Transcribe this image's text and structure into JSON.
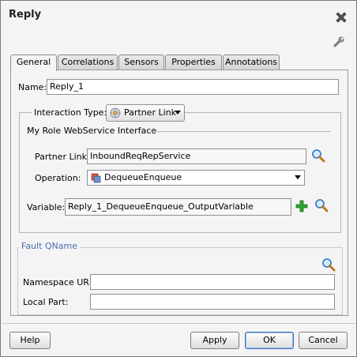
{
  "dialog": {
    "title": "Reply"
  },
  "tabs": [
    {
      "label": "General",
      "active": true
    },
    {
      "label": "Correlations",
      "active": false
    },
    {
      "label": "Sensors",
      "active": false
    },
    {
      "label": "Properties",
      "active": false
    },
    {
      "label": "Annotations",
      "active": false
    }
  ],
  "general": {
    "name_label": "Name:",
    "name_value": "Reply_1",
    "interaction_type_label": "Interaction Type:",
    "interaction_type_value": "Partner Link",
    "role_section_label": "My Role WebService Interface",
    "partner_link_label": "Partner Link:",
    "partner_link_value": "InboundReqRepService",
    "operation_label": "Operation:",
    "operation_value": "DequeueEnqueue",
    "variable_label": "Variable:",
    "variable_value": "Reply_1_DequeueEnqueue_OutputVariable"
  },
  "fault": {
    "section_label": "Fault QName",
    "namespace_label": "Namespace URI:",
    "namespace_value": "",
    "local_part_label": "Local Part:",
    "local_part_value": ""
  },
  "buttons": {
    "help": "Help",
    "apply": "Apply",
    "ok": "OK",
    "cancel": "Cancel"
  },
  "colors": {
    "fault_legend": "#4a6fb0",
    "add_icon": "#2ea52e",
    "search_icon": "#3d7fc9"
  }
}
